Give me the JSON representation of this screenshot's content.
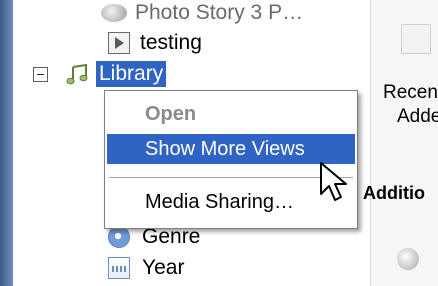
{
  "tree": {
    "photo_story": "Photo Story 3 P…",
    "testing": "testing",
    "library": "Library",
    "genre": "Genre",
    "year": "Year"
  },
  "context_menu": {
    "items": [
      {
        "label": "Open",
        "state": "disabled"
      },
      {
        "label": "Show More Views",
        "state": "selected"
      },
      {
        "label": "Media Sharing…",
        "state": "normal"
      }
    ]
  },
  "right_panel": {
    "recent_line1": "Recen",
    "recent_line2": "Adde",
    "additional": "Additio"
  },
  "colors": {
    "selection": "#2f64c4",
    "menu_border": "#7f7f7f",
    "disabled_text": "#8a8a8a"
  }
}
